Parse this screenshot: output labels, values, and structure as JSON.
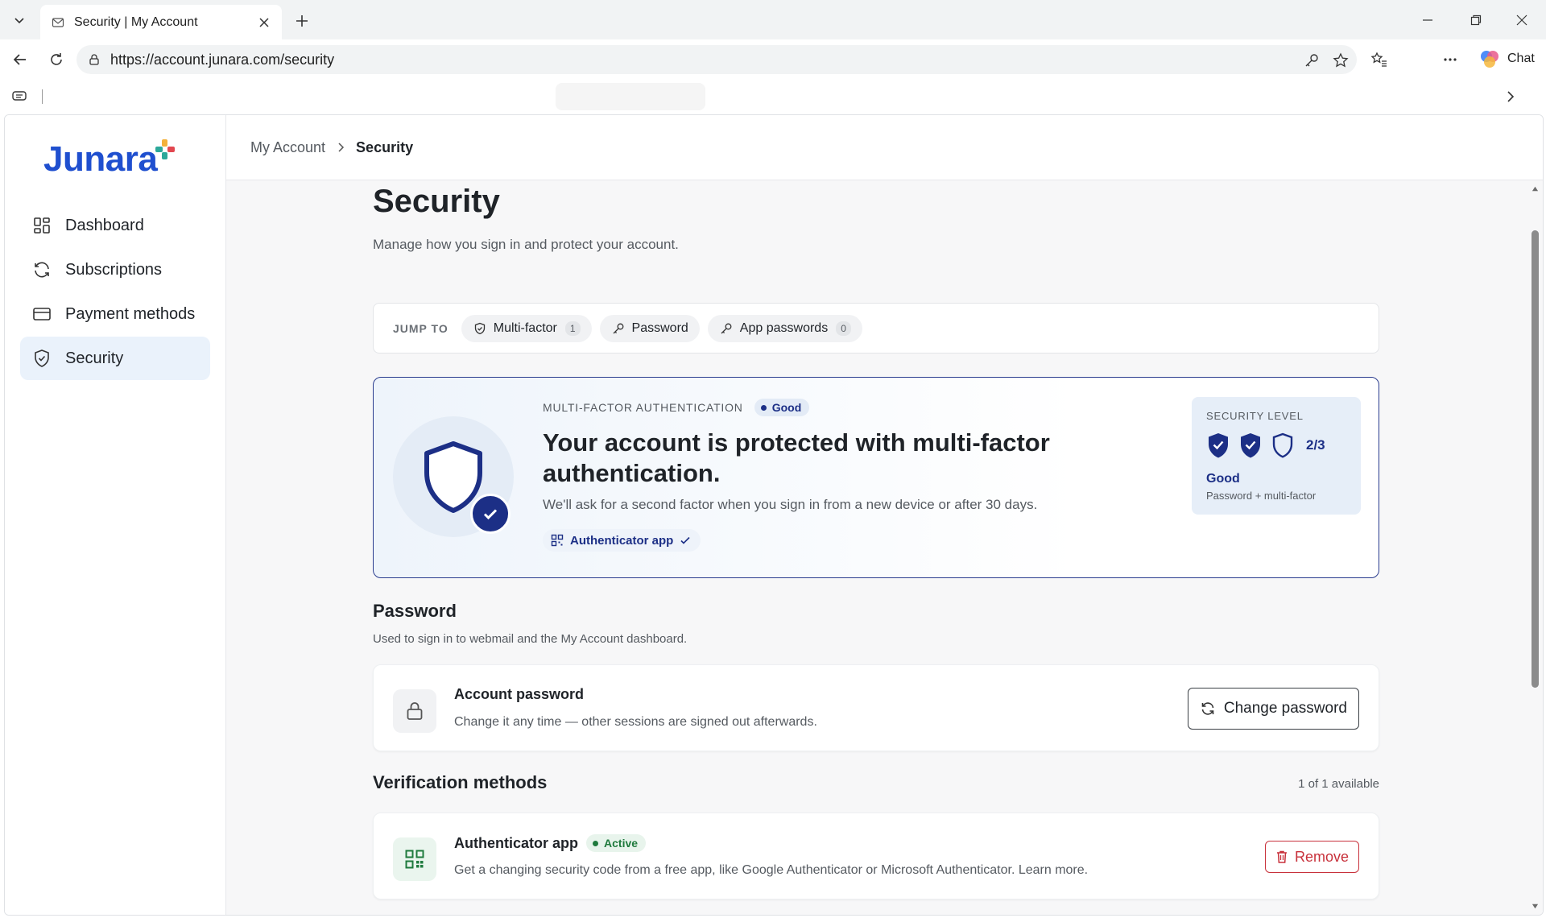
{
  "browser": {
    "tab_title": "Security | My Account",
    "url": "https://account.junara.com/security",
    "chat_label": "Chat"
  },
  "brand": {
    "name": "Junara",
    "color": "#1f4fcf"
  },
  "sidebar": {
    "items": [
      {
        "label": "Dashboard",
        "icon": "dashboard-icon",
        "active": false
      },
      {
        "label": "Subscriptions",
        "icon": "refresh-icon",
        "active": false
      },
      {
        "label": "Payment methods",
        "icon": "credit-card-icon",
        "active": false
      },
      {
        "label": "Security",
        "icon": "shield-check-icon",
        "active": true
      }
    ]
  },
  "breadcrumb": {
    "parent": "My Account",
    "current": "Security"
  },
  "page": {
    "title": "Security",
    "subtitle": "Manage how you sign in and protect your account."
  },
  "jump": {
    "label": "JUMP TO",
    "chips": [
      {
        "label": "Multi-factor",
        "count": "1",
        "icon": "shield-icon"
      },
      {
        "label": "Password",
        "icon": "key-icon"
      },
      {
        "label": "App passwords",
        "count": "0",
        "icon": "key-icon"
      }
    ]
  },
  "mfa": {
    "eyebrow": "MULTI-FACTOR AUTHENTICATION",
    "badge": "Good",
    "title": "Your account is protected with multi-factor authentication.",
    "description": "We'll ask for a second factor when you sign in from a new device or after 30 days.",
    "method_chip": "Authenticator app"
  },
  "security_level": {
    "label": "SECURITY LEVEL",
    "value": 2,
    "max": 3,
    "fraction_text": "2/3",
    "level_text": "Good",
    "detail": "Password + multi-factor"
  },
  "password_section": {
    "title": "Password",
    "subtitle": "Used to sign in to webmail and the My Account dashboard.",
    "card_title": "Account password",
    "card_desc": "Change it any time — other sessions are signed out afterwards.",
    "button": "Change password"
  },
  "verification": {
    "title": "Verification methods",
    "availability": "1 of 1 available",
    "card_title": "Authenticator app",
    "status": "Active",
    "card_desc": "Get a changing security code from a free app, like Google Authenticator or Microsoft Authenticator. Learn more.",
    "button": "Remove"
  },
  "colors": {
    "accent": "#1c2f86",
    "active_green": "#1f7a3d",
    "danger": "#c8313b",
    "sidebar_active_bg": "#eaf2fb"
  }
}
